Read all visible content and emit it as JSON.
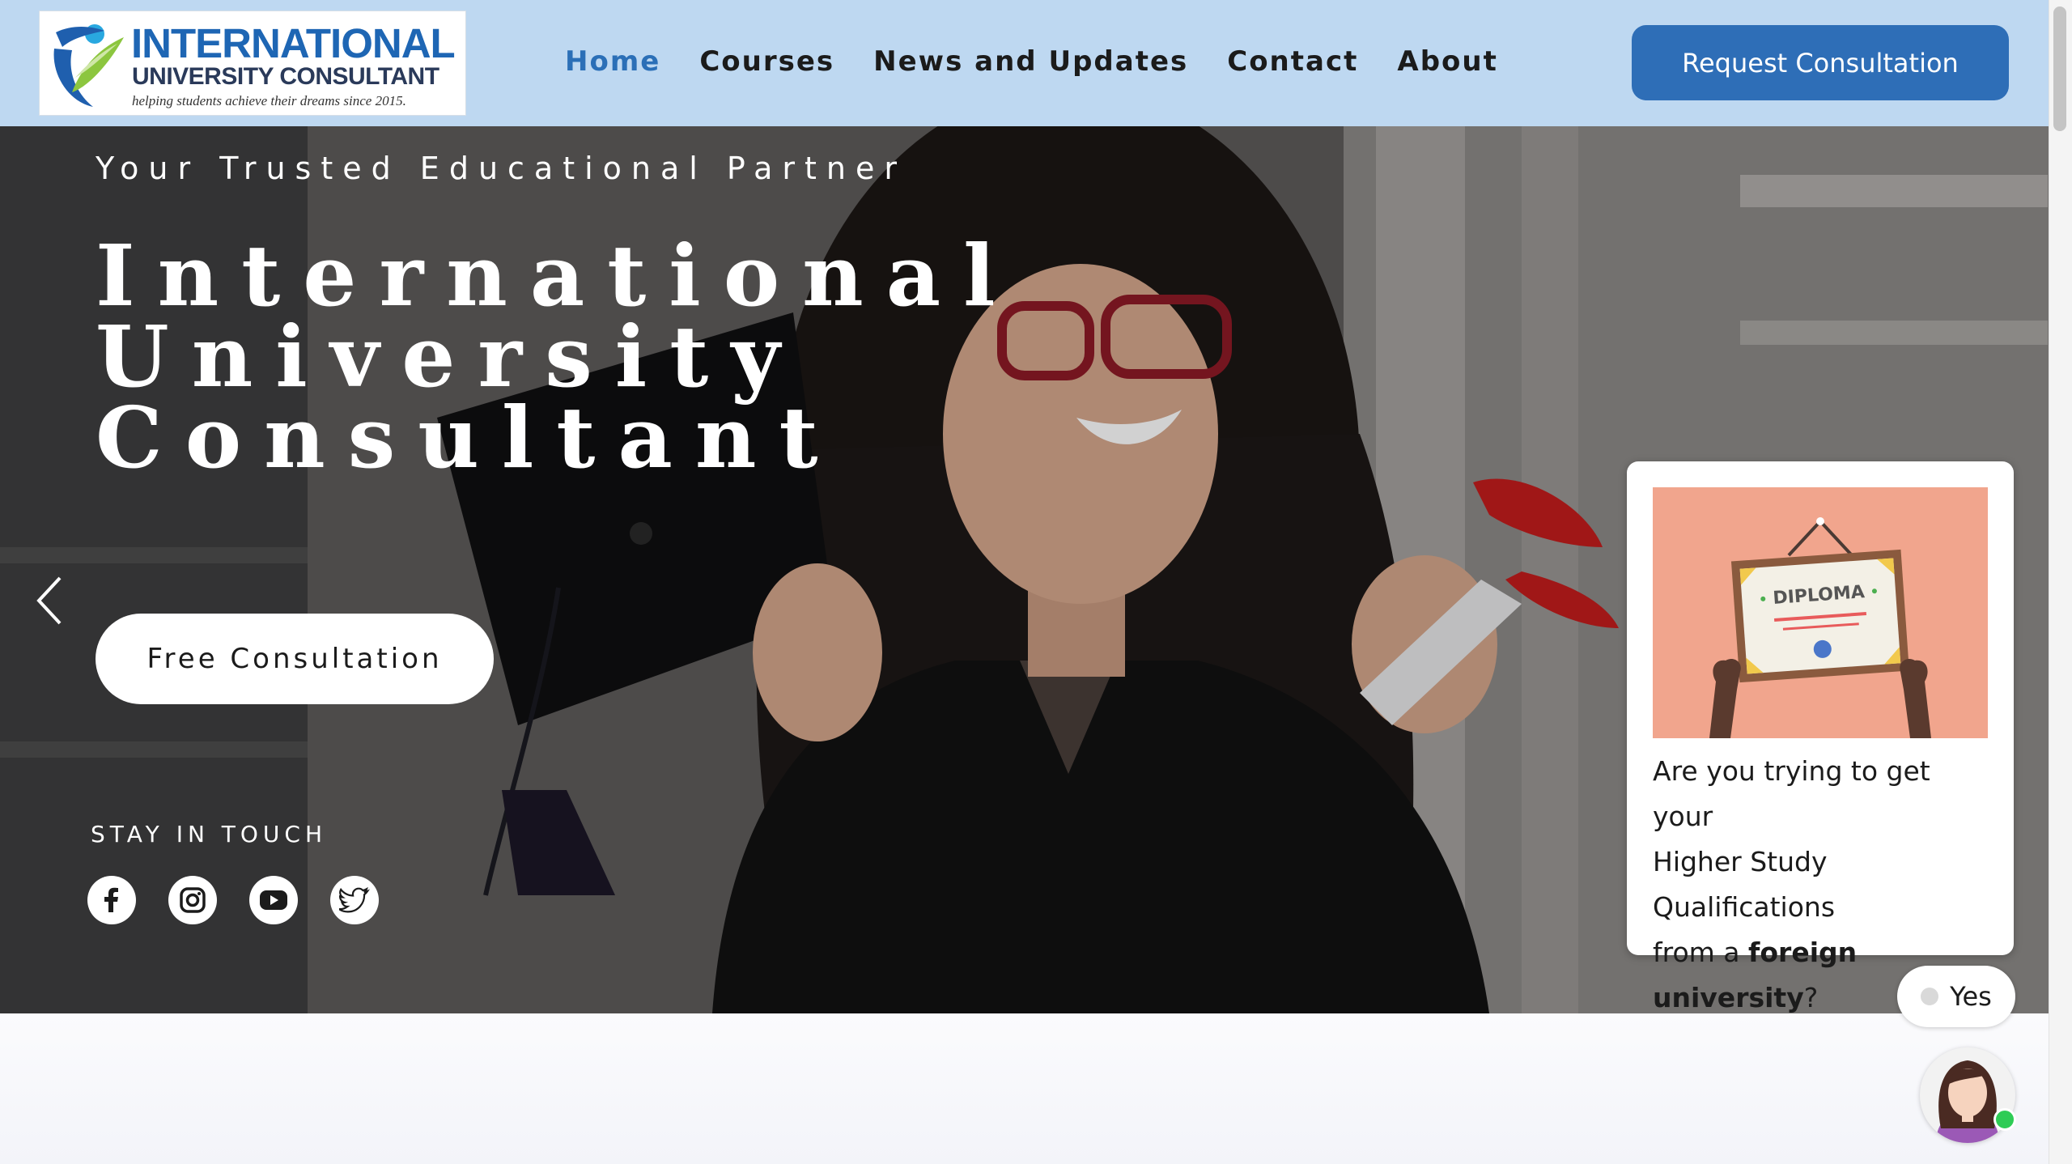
{
  "header": {
    "logo": {
      "title": "INTERNATIONAL",
      "subtitle": "UNIVERSITY CONSULTANT",
      "tagline": "helping students achieve their dreams since 2015."
    },
    "nav": [
      {
        "label": "Home",
        "active": true
      },
      {
        "label": "Courses",
        "active": false
      },
      {
        "label": "News and Updates",
        "active": false
      },
      {
        "label": "Contact",
        "active": false
      },
      {
        "label": "About",
        "active": false
      }
    ],
    "cta_label": "Request Consultation"
  },
  "hero": {
    "tagline": "Your Trusted Educational Partner",
    "title_lines": [
      "International",
      "University",
      "Consultant"
    ],
    "button_label": "Free Consultation",
    "stay_label": "STAY IN TOUCH",
    "socials": [
      "facebook-icon",
      "instagram-icon",
      "youtube-icon",
      "twitter-icon"
    ]
  },
  "chat": {
    "image_text": "DIPLOMA",
    "message_lines": [
      "Are you trying to get your",
      "Higher Study Qualifications",
      "from a"
    ],
    "message_bold_1": "foreign",
    "message_bold_2": "university",
    "message_end": "?",
    "reply_label": "Yes"
  },
  "colors": {
    "header_bg": "#bed8f1",
    "accent": "#2e6eb7",
    "nav_active": "#2b6fb7",
    "online": "#2ecc55"
  }
}
